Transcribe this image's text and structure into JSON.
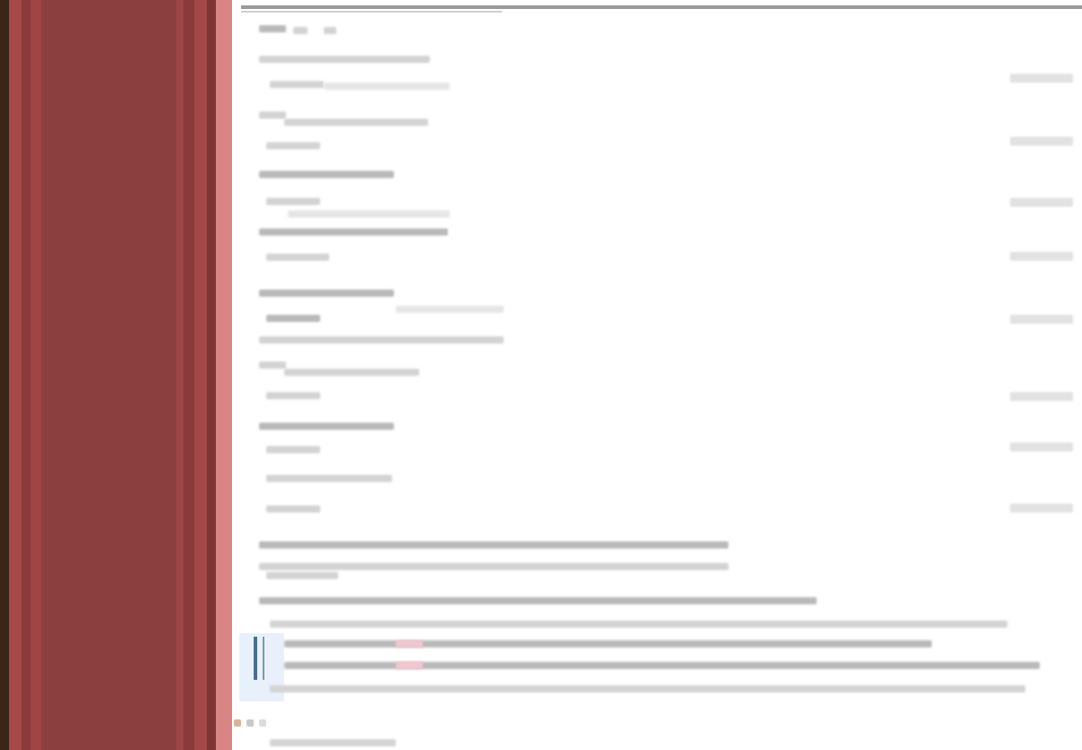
{
  "window": {
    "title": ""
  },
  "colors": {
    "sidebar_bg": "#8c3f3f",
    "sidebar_dark": "#3b2418",
    "sidebar_accent": "#a84848",
    "sidebar_edge": "#d98585",
    "selection": "#e8f1fb",
    "cursor": "#4a6f8d",
    "highlight": "#f2c6cf"
  },
  "editor": {
    "lines_visible": 26,
    "highlighted_tokens": 2
  },
  "status": {
    "label": ""
  }
}
